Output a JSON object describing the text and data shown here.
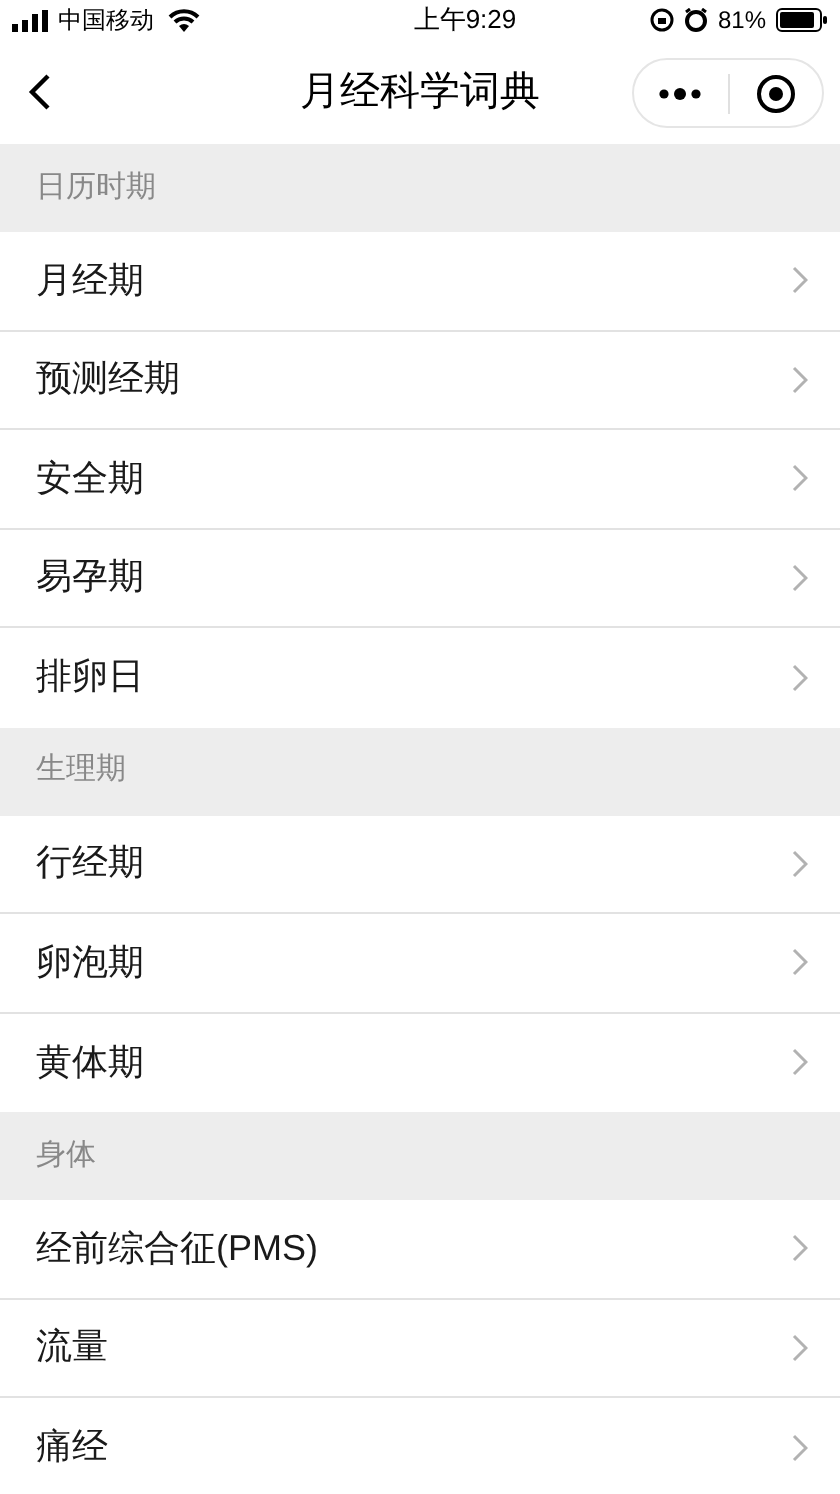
{
  "status_bar": {
    "carrier": "中国移动",
    "time": "上午9:29",
    "battery_text": "81%"
  },
  "nav_bar": {
    "title": "月经科学词典"
  },
  "sections": [
    {
      "title": "日历时期",
      "items": [
        {
          "label": "月经期"
        },
        {
          "label": "预测经期"
        },
        {
          "label": "安全期"
        },
        {
          "label": "易孕期"
        },
        {
          "label": "排卵日"
        }
      ]
    },
    {
      "title": "生理期",
      "items": [
        {
          "label": "行经期"
        },
        {
          "label": "卵泡期"
        },
        {
          "label": "黄体期"
        }
      ]
    },
    {
      "title": "身体",
      "items": [
        {
          "label": "经前综合征(PMS)"
        },
        {
          "label": "流量"
        },
        {
          "label": "痛经"
        }
      ]
    }
  ]
}
